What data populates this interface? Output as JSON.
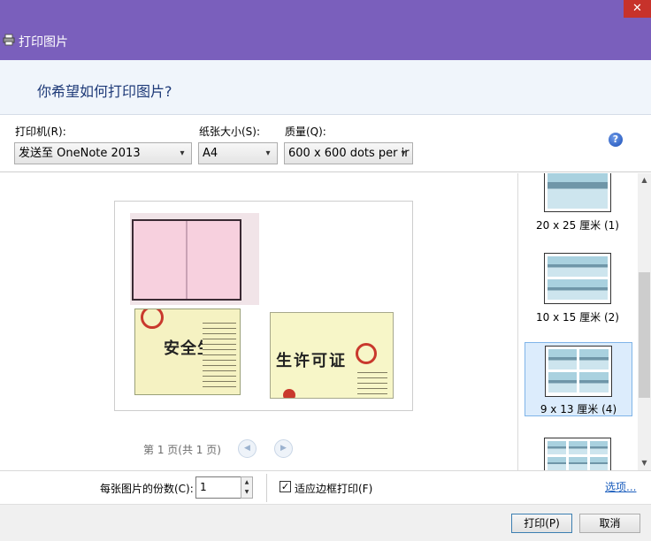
{
  "window": {
    "title": "打印图片",
    "close_glyph": "✕"
  },
  "header": {
    "question": "你希望如何打印图片?"
  },
  "options": {
    "printer_label": "打印机(R):",
    "printer_value": "发送至 OneNote 2013",
    "paper_label": "纸张大小(S):",
    "paper_value": "A4",
    "quality_label": "质量(Q):",
    "quality_value": "600 x 600 dots per ir",
    "help_glyph": "?"
  },
  "preview": {
    "photo2_text": "安全生产",
    "photo3_text": "生许可证",
    "page_text": "第 1 页(共 1 页)",
    "prev_glyph": "◀",
    "next_glyph": "▶"
  },
  "layouts": [
    {
      "label": "20 x 25 厘米 (1)"
    },
    {
      "label": "10 x 15 厘米 (2)"
    },
    {
      "label": "9 x 13 厘米 (4)"
    }
  ],
  "copies": {
    "label": "每张图片的份数(C):",
    "value": "1",
    "fit_label": "适应边框打印(F)",
    "fit_checked_glyph": "✓",
    "options_link": "选项..."
  },
  "footer": {
    "print_label": "打印(P)",
    "cancel_label": "取消"
  }
}
